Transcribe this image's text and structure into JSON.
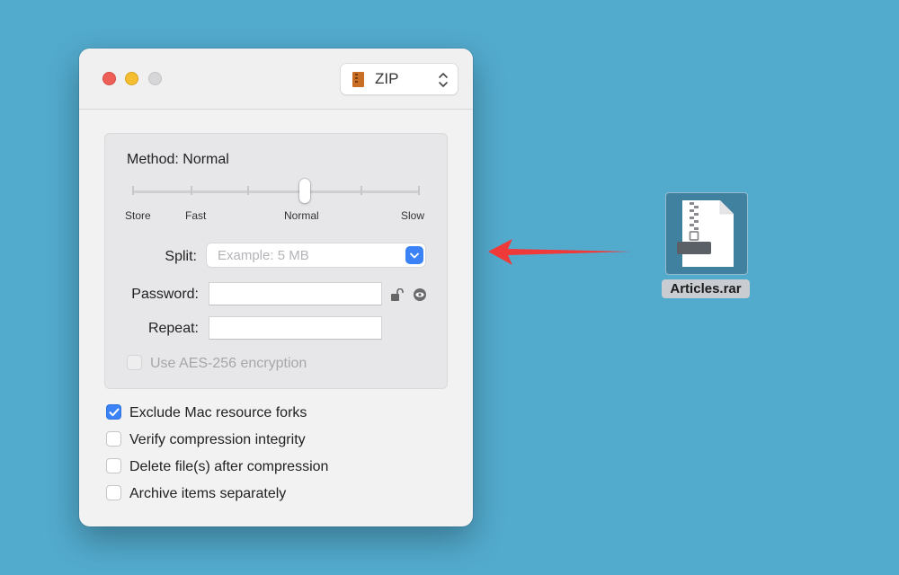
{
  "window": {
    "traffic_lights": [
      "close",
      "minimize",
      "zoom"
    ],
    "format_select": {
      "label": "ZIP",
      "icon": "zip-archive-icon"
    }
  },
  "options": {
    "method_label": "Method: Normal",
    "slider": {
      "value_index": 3,
      "tick_count": 6,
      "labels": [
        "Store",
        "Fast",
        "Normal",
        "Slow"
      ]
    },
    "split": {
      "label": "Split:",
      "value": "",
      "placeholder": "Example: 5 MB"
    },
    "password": {
      "label": "Password:",
      "value": ""
    },
    "repeat": {
      "label": "Repeat:",
      "value": ""
    },
    "aes": {
      "label": "Use AES-256 encryption",
      "checked": false,
      "enabled": false
    }
  },
  "checkboxes": [
    {
      "label": "Exclude Mac resource forks",
      "checked": true
    },
    {
      "label": "Verify compression integrity",
      "checked": false
    },
    {
      "label": "Delete file(s) after compression",
      "checked": false
    },
    {
      "label": "Archive items separately",
      "checked": false
    }
  ],
  "desktop_file": {
    "name": "Articles.rar",
    "icon": "archive-file-icon"
  },
  "colors": {
    "desktop": "#52aacd",
    "accent": "#3a82f6",
    "arrow": "#f03a3a"
  }
}
